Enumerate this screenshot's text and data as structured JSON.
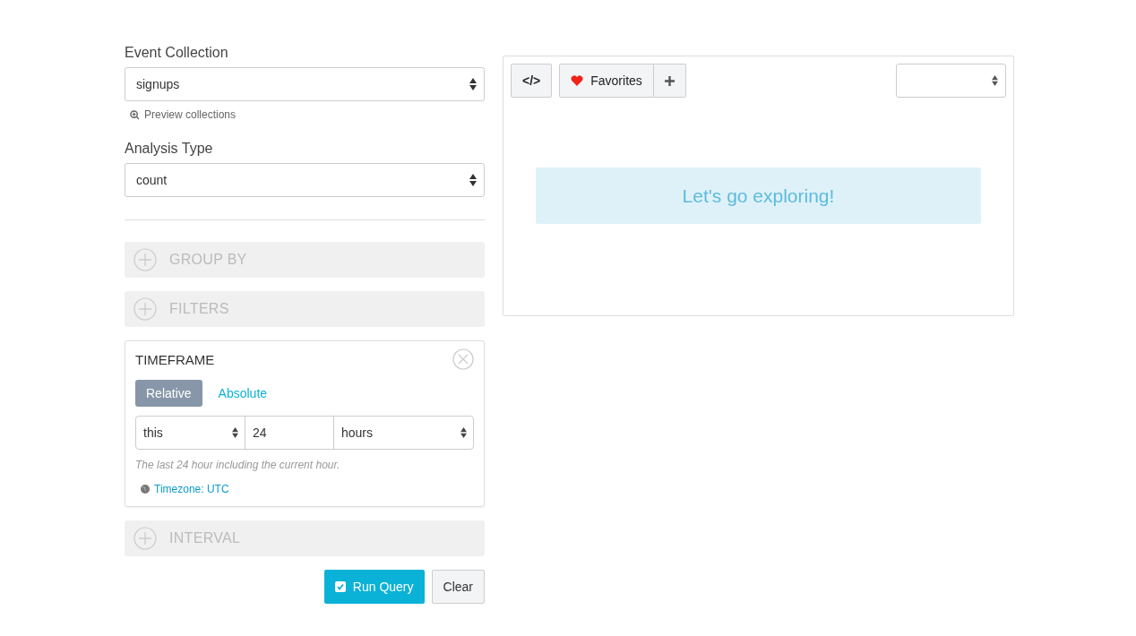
{
  "event_collection": {
    "label": "Event Collection",
    "value": "signups",
    "preview_link": "Preview collections"
  },
  "analysis_type": {
    "label": "Analysis Type",
    "value": "count"
  },
  "sections": [
    {
      "title": "GROUP BY",
      "expanded": false
    },
    {
      "title": "FILTERS",
      "expanded": false
    },
    {
      "title": "TIMEFRAME",
      "expanded": true
    },
    {
      "title": "INTERVAL",
      "expanded": false
    }
  ],
  "timeframe": {
    "tabs": [
      {
        "label": "Relative",
        "selected": true
      },
      {
        "label": "Absolute",
        "selected": false
      }
    ],
    "relativity": "this",
    "amount": "24",
    "unit": "hours",
    "hint": "The last 24 hour including the current hour.",
    "timezone_link": "Timezone: UTC"
  },
  "actions": {
    "run": "Run Query",
    "clear": "Clear"
  },
  "results": {
    "code_button": "</>",
    "favorites_button": "Favorites",
    "message": "Let's go exploring!"
  }
}
